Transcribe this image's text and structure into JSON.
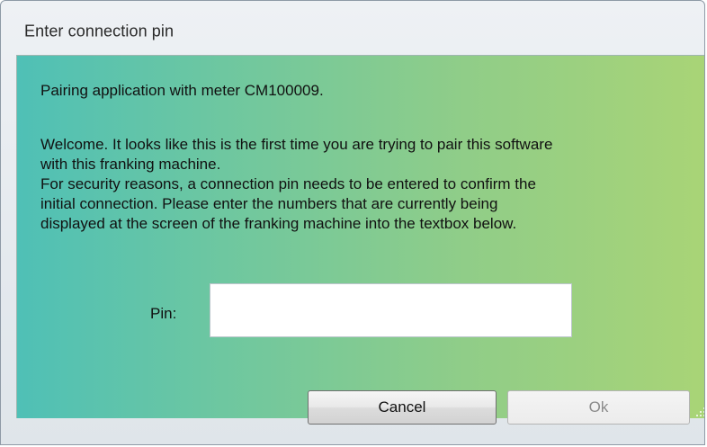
{
  "window": {
    "title": "Enter connection pin"
  },
  "dialog": {
    "pairing_text": "Pairing application with meter CM100009.",
    "welcome_lines": [
      "Welcome. It looks like this is the first time you are trying to pair this software",
      "with this franking machine.",
      "For security reasons, a connection pin needs to be entered to confirm the",
      "initial connection. Please enter the numbers that are currently being",
      "displayed at the screen of the franking machine into the textbox below."
    ],
    "pin_label": "Pin:",
    "pin_value": "",
    "cancel_label": "Cancel",
    "ok_label": "Ok"
  },
  "colors": {
    "gradient_left": "#4fc0b6",
    "gradient_right": "#a9d476"
  }
}
